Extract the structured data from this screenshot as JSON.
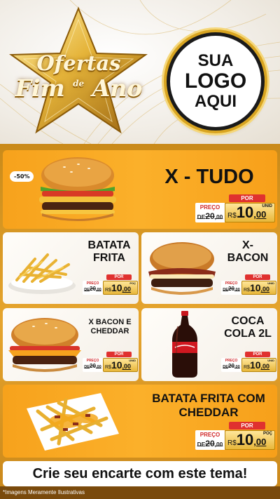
{
  "header": {
    "star_line1": "Ofertas",
    "star_line2a": "Fim",
    "star_de": "de",
    "star_line2b": "Ano",
    "logo_l1": "SUA",
    "logo_l2": "LOGO",
    "logo_l3": "AQUI"
  },
  "products": [
    {
      "name": "X - TUDO",
      "badge": "-50%",
      "por": "POR",
      "preco": "PREÇO",
      "de": "DE",
      "old": "20",
      "old_cents": ",00",
      "currency": "R$",
      "price": "10",
      "cents": ",00",
      "unit": "UNID"
    },
    {
      "name_l1": "BATATA",
      "name_l2": "FRITA",
      "por": "POR",
      "preco": "PREÇO",
      "de": "DE",
      "old": "20",
      "old_cents": ",00",
      "currency": "R$",
      "price": "10",
      "cents": ",00",
      "unit": "POÇ"
    },
    {
      "name_l1": "X-",
      "name_l2": "BACON",
      "por": "POR",
      "preco": "PREÇO",
      "de": "DE",
      "old": "20",
      "old_cents": ",00",
      "currency": "R$",
      "price": "10",
      "cents": ",00",
      "unit": "UNID"
    },
    {
      "name_l1": "X BACON E",
      "name_l2": "CHEDDAR",
      "por": "POR",
      "preco": "PREÇO",
      "de": "DE",
      "old": "20",
      "old_cents": ",00",
      "currency": "R$",
      "price": "10",
      "cents": ",00",
      "unit": "UNID"
    },
    {
      "name_l1": "COCA",
      "name_l2": "COLA 2L",
      "por": "POR",
      "preco": "PREÇO",
      "de": "DE",
      "old": "20",
      "old_cents": ",00",
      "currency": "R$",
      "price": "10",
      "cents": ",00",
      "unit": "UNID"
    },
    {
      "name_l1": "BATATA FRITA COM",
      "name_l2": "CHEDDAR",
      "por": "POR",
      "preco": "PREÇO",
      "de": "DE",
      "old": "20",
      "old_cents": ",00",
      "currency": "R$",
      "price": "10",
      "cents": ",00",
      "unit": "POÇ"
    }
  ],
  "footer": {
    "cta": "Crie seu encarte com este tema!",
    "disclaimer": "*Imagens Meramente Ilustrativas"
  },
  "colors": {
    "orange": "#f7a21c",
    "gold": "#e8b73a",
    "red": "#e0312f",
    "brown": "#7a4a0c"
  }
}
